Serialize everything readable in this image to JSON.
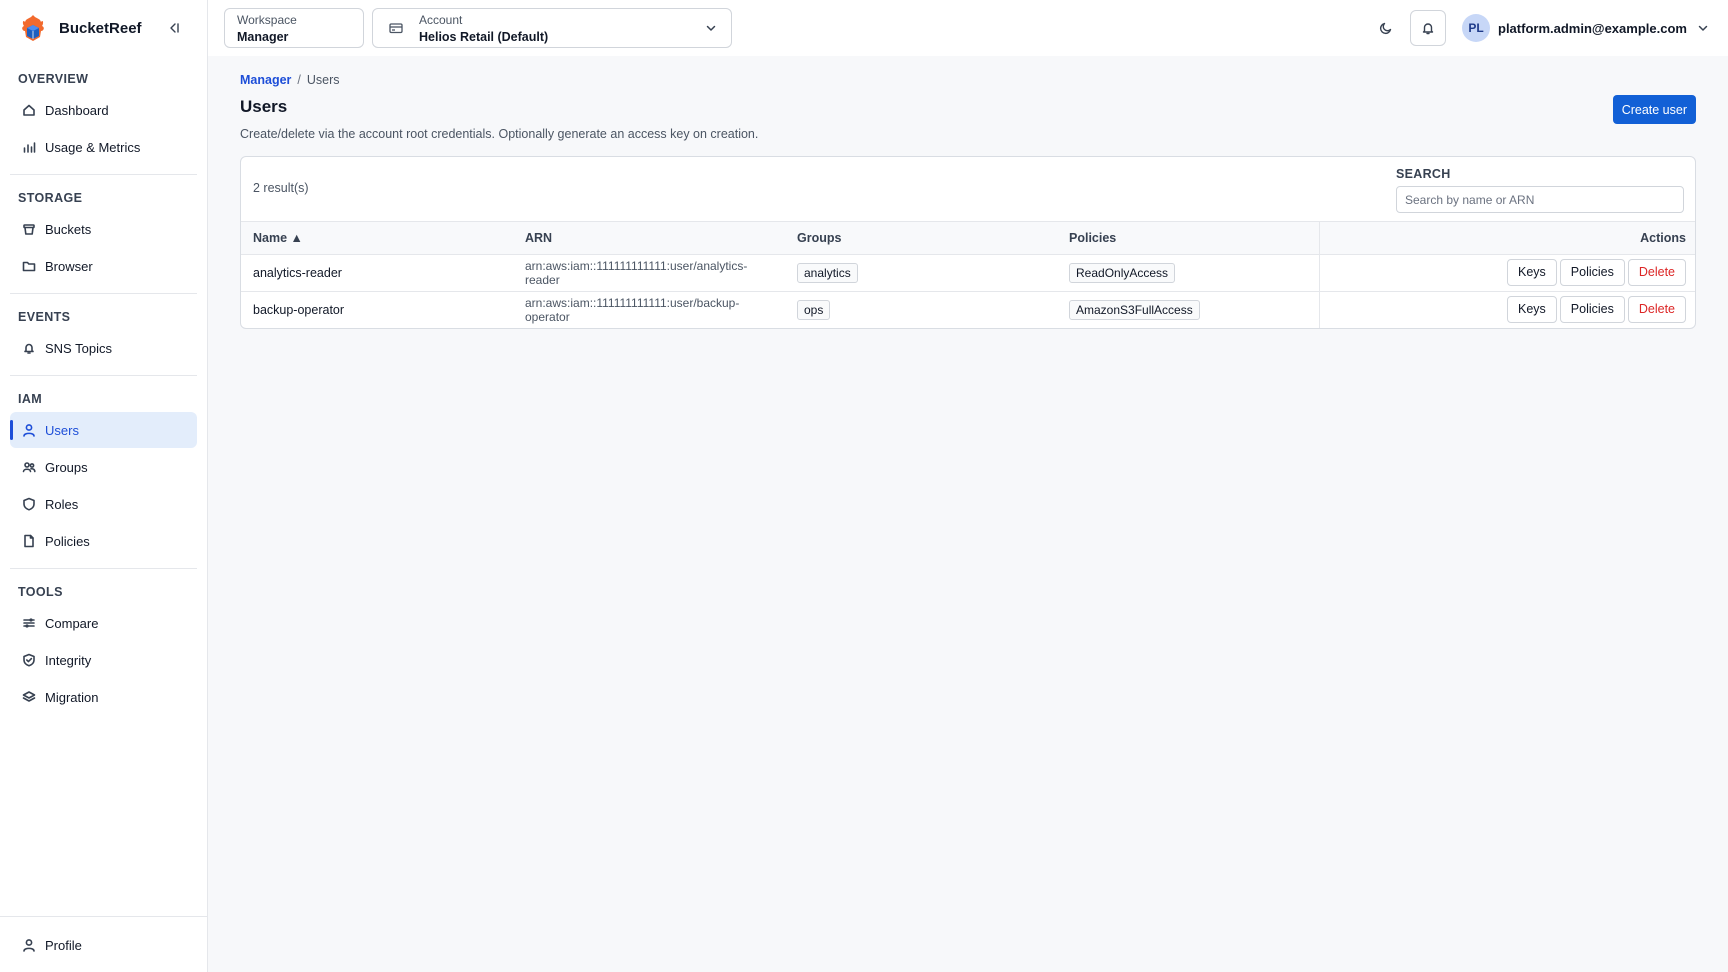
{
  "brand": {
    "name": "BucketReef"
  },
  "sidebar": {
    "sections": [
      {
        "title": "OVERVIEW",
        "items": [
          {
            "label": "Dashboard",
            "icon": "home-icon"
          },
          {
            "label": "Usage & Metrics",
            "icon": "bar-chart-icon"
          }
        ]
      },
      {
        "title": "STORAGE",
        "items": [
          {
            "label": "Buckets",
            "icon": "bucket-icon"
          },
          {
            "label": "Browser",
            "icon": "folder-icon"
          }
        ]
      },
      {
        "title": "EVENTS",
        "items": [
          {
            "label": "SNS Topics",
            "icon": "bell-icon"
          }
        ]
      },
      {
        "title": "IAM",
        "items": [
          {
            "label": "Users",
            "icon": "user-icon",
            "active": true
          },
          {
            "label": "Groups",
            "icon": "users-icon"
          },
          {
            "label": "Roles",
            "icon": "shield-icon"
          },
          {
            "label": "Policies",
            "icon": "file-icon"
          }
        ]
      },
      {
        "title": "TOOLS",
        "items": [
          {
            "label": "Compare",
            "icon": "sliders-icon"
          },
          {
            "label": "Integrity",
            "icon": "shield-check-icon"
          },
          {
            "label": "Migration",
            "icon": "layers-icon"
          }
        ]
      }
    ],
    "profile_label": "Profile"
  },
  "topbar": {
    "workspace": {
      "label": "Workspace",
      "value": "Manager"
    },
    "account": {
      "label": "Account",
      "value": "Helios Retail (Default)"
    },
    "user": {
      "initials": "PL",
      "email": "platform.admin@example.com"
    }
  },
  "breadcrumb": {
    "parent": "Manager",
    "separator": "/",
    "current": "Users"
  },
  "page": {
    "title": "Users",
    "description": "Create/delete via the account root credentials. Optionally generate an access key on creation.",
    "create_button": "Create user"
  },
  "table": {
    "result_count": "2 result(s)",
    "search_label": "SEARCH",
    "search_placeholder": "Search by name or ARN",
    "columns": {
      "name": "Name ▲",
      "arn": "ARN",
      "groups": "Groups",
      "policies": "Policies",
      "actions": "Actions"
    },
    "rows": [
      {
        "name": "analytics-reader",
        "arn": "arn:aws:iam::111111111111:user/analytics-reader",
        "group": "analytics",
        "policy": "ReadOnlyAccess"
      },
      {
        "name": "backup-operator",
        "arn": "arn:aws:iam::111111111111:user/backup-operator",
        "group": "ops",
        "policy": "AmazonS3FullAccess"
      }
    ],
    "actions": {
      "keys": "Keys",
      "policies": "Policies",
      "delete": "Delete"
    }
  },
  "colors": {
    "accent": "#1260d6",
    "active_bg": "#e3edfb",
    "danger": "#dc2626"
  }
}
